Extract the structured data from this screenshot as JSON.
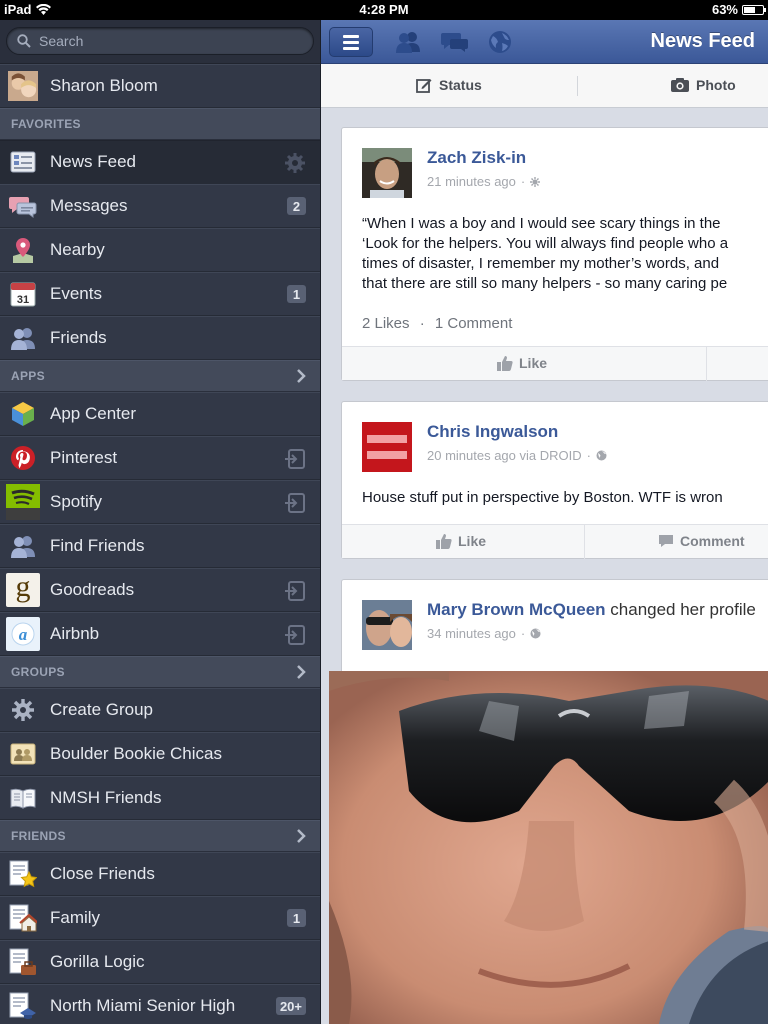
{
  "status_bar": {
    "device": "iPad",
    "time": "4:28 PM",
    "battery": "63%",
    "battery_level": 0.63
  },
  "sidebar": {
    "search_placeholder": "Search",
    "profile": {
      "name": "Sharon Bloom"
    },
    "sections": {
      "favorites": "FAVORITES",
      "apps": "APPS",
      "groups": "GROUPS",
      "friends": "FRIENDS"
    },
    "favorites": [
      {
        "label": "News Feed",
        "icon": "news-feed-icon"
      },
      {
        "label": "Messages",
        "icon": "messages-icon",
        "badge": "2"
      },
      {
        "label": "Nearby",
        "icon": "nearby-pin-icon"
      },
      {
        "label": "Events",
        "icon": "calendar-icon",
        "badge": "1",
        "calendar_day": "31"
      },
      {
        "label": "Friends",
        "icon": "friends-icon"
      }
    ],
    "apps": [
      {
        "label": "App Center",
        "icon": "app-center-icon"
      },
      {
        "label": "Pinterest",
        "icon": "pinterest-icon"
      },
      {
        "label": "Spotify",
        "icon": "spotify-icon"
      },
      {
        "label": "Find Friends",
        "icon": "find-friends-icon"
      },
      {
        "label": "Goodreads",
        "icon": "goodreads-icon",
        "glyph": "g"
      },
      {
        "label": "Airbnb",
        "icon": "airbnb-icon"
      }
    ],
    "groups": [
      {
        "label": "Create Group",
        "icon": "gear-icon"
      },
      {
        "label": "Boulder Bookie Chicas",
        "icon": "group-icon"
      },
      {
        "label": "NMSH Friends",
        "icon": "book-icon"
      }
    ],
    "friends": [
      {
        "label": "Close Friends",
        "icon": "star-list-icon"
      },
      {
        "label": "Family",
        "icon": "house-list-icon",
        "badge": "1"
      },
      {
        "label": "Gorilla Logic",
        "icon": "briefcase-list-icon"
      },
      {
        "label": "North Miami Senior High",
        "icon": "school-list-icon",
        "badge": "20+"
      }
    ]
  },
  "main": {
    "title": "News Feed",
    "composer": {
      "status": "Status",
      "photo": "Photo"
    },
    "posts": [
      {
        "author": "Zach Zisk-in",
        "time": "21 minutes ago",
        "lines": [
          "“When I was a boy and I would see scary things in the",
          "‘Look for the helpers. You will always find people who a",
          "times of disaster, I remember my mother’s words, and",
          "that there are still so many helpers - so many caring pe"
        ],
        "likes": "2 Likes",
        "comments": "1 Comment",
        "like_label": "Like"
      },
      {
        "author": "Chris Ingwalson",
        "time": "20 minutes ago via DROID",
        "text": "House stuff put in perspective by Boston. WTF is wron",
        "like_label": "Like",
        "comment_label": "Comment"
      },
      {
        "author": "Mary Brown McQueen",
        "action": "changed her profile",
        "time": "34 minutes ago"
      }
    ]
  },
  "colors": {
    "brand": "#3b5998",
    "sidebar": "#323847"
  }
}
